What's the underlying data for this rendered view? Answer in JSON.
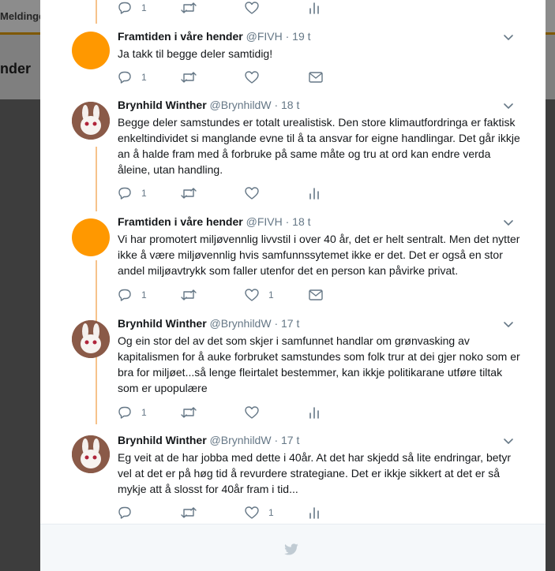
{
  "background": {
    "menu_label": "Meldinge",
    "header_title": "nder"
  },
  "thread": {
    "top_actions": {
      "reply_count": "1",
      "like_count": ""
    },
    "tweets": [
      {
        "name": "Framtiden i våre hender",
        "handle": "@FIVH",
        "time": "19 t",
        "avatar": "orange-circle",
        "text": "Ja takk til begge deler samtidig!",
        "reply_count": "1",
        "like_count": ""
      },
      {
        "name": "Brynhild Winther",
        "handle": "@BrynhildW",
        "time": "18 t",
        "avatar": "bunny-photo",
        "text": "Begge deler samstundes er totalt urealistisk. Den store klimautfordringa er faktisk enkeltindividet si manglande evne til å ta ansvar for eigne handlingar. Det går ikkje an å halde fram med å forbruke på same måte og tru at ord kan endre verda åleine, utan handling.",
        "reply_count": "1",
        "like_count": ""
      },
      {
        "name": "Framtiden i våre hender",
        "handle": "@FIVH",
        "time": "18 t",
        "avatar": "orange-circle",
        "text": "Vi har promotert miljøvennlig livvstil i over 40 år, det er helt sentralt. Men det nytter ikke å være miljøvennlig hvis samfunnssytemet ikke er det. Det er også en stor andel miljøavtrykk som faller utenfor det en person kan påvirke privat.",
        "reply_count": "1",
        "like_count": "1"
      },
      {
        "name": "Brynhild Winther",
        "handle": "@BrynhildW",
        "time": "17 t",
        "avatar": "bunny-photo",
        "text": "Og ein stor del av det som skjer i samfunnet handlar om grønvasking av kapitalismen for å auke forbruket samstundes som folk trur at dei gjer noko som er bra for miljøet...så lenge fleirtalet bestemmer, kan ikkje politikarane utføre tiltak som er upopulære",
        "reply_count": "1",
        "like_count": ""
      },
      {
        "name": "Brynhild Winther",
        "handle": "@BrynhildW",
        "time": "17 t",
        "avatar": "bunny-photo",
        "text": "Eg veit at de har jobba med dette i 40år. At det har skjedd så lite endringar, betyr vel at det er på høg tid å revurdere strategiane. Det er ikkje sikkert at det er så mykje att å slosst for 40år fram i tid...",
        "reply_count": "",
        "like_count": "1"
      }
    ]
  },
  "icons": {
    "reply": "reply-icon",
    "retweet": "retweet-icon",
    "like": "heart-icon",
    "dm": "envelope-icon",
    "analytics": "bar-chart-icon",
    "caret": "chevron-down-icon",
    "footer": "twitter-bird-icon"
  },
  "colors": {
    "accent": "#e8a000",
    "thread_line": "#f6c28b",
    "avatar_orange": "#ff9800",
    "meta_gray": "#657786"
  }
}
